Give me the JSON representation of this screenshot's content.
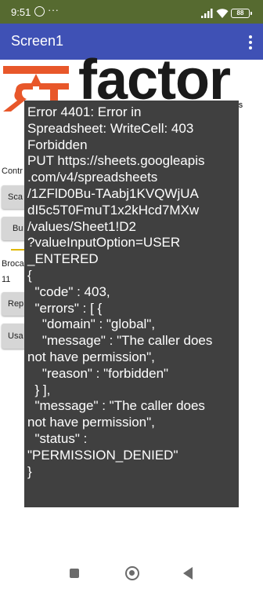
{
  "status_bar": {
    "time": "9:51",
    "dots": "···",
    "battery": "88",
    "icons": [
      "whatsapp-icon",
      "signal-icon",
      "wifi-icon",
      "battery-icon"
    ]
  },
  "app_bar": {
    "title": "Screen1",
    "menu_icon": "more-vert-icon",
    "color": "#3F51B5"
  },
  "logo": {
    "text": "factor",
    "tagline": "NS",
    "mark_color": "#E8572A"
  },
  "background_form": {
    "labels": [
      "Contr",
      "Broca",
      "11"
    ],
    "buttons": [
      "Sca",
      "Bu",
      "Rep",
      "Usa"
    ]
  },
  "error_toast": {
    "lines": [
      "Error 4401: Error in",
      "Spreadsheet: WriteCell: 403",
      "Forbidden",
      "PUT https://sheets.googleapis",
      ".com/v4/spreadsheets",
      "/1ZFlD0Bu-TAabj1KVQWjUA",
      "dI5c5T0FmuT1x2kHcd7MXw",
      "/values/Sheet1!D2",
      "?valueInputOption=USER",
      "_ENTERED",
      "{",
      "  \"code\" : 403,",
      "  \"errors\" : [ {",
      "    \"domain\" : \"global\",",
      "    \"message\" : \"The caller does",
      "not have permission\",",
      "    \"reason\" : \"forbidden\"",
      "  } ],",
      "  \"message\" : \"The caller does",
      "not have permission\",",
      "  \"status\" :",
      "\"PERMISSION_DENIED\"",
      "}"
    ],
    "background": "#404040"
  },
  "nav_bar": {
    "icons": [
      "recent-apps-icon",
      "home-icon",
      "back-icon"
    ]
  }
}
